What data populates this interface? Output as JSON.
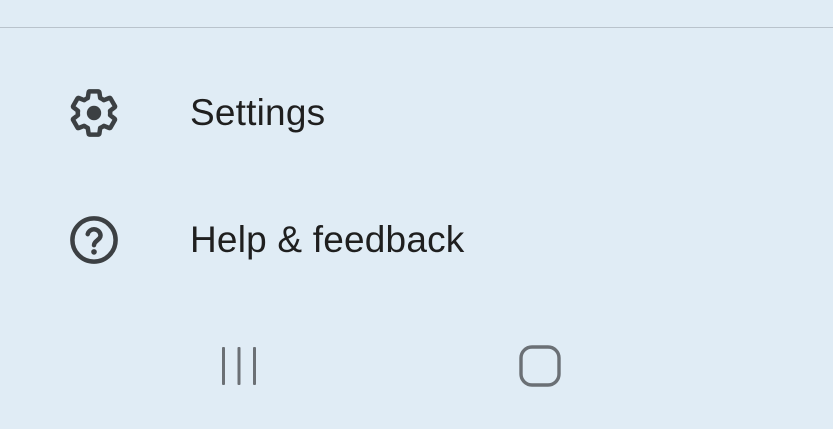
{
  "menu": {
    "items": [
      {
        "label": "Settings",
        "icon": "gear-icon"
      },
      {
        "label": "Help & feedback",
        "icon": "help-circle-icon"
      }
    ]
  },
  "navigation_bar": {
    "buttons": [
      {
        "icon": "recents-icon"
      },
      {
        "icon": "home-icon"
      }
    ]
  },
  "colors": {
    "background": "#e0ecf5",
    "divider": "#b9c3cc",
    "icon": "#3c4043",
    "text": "#1f1f1f",
    "nav_icon": "#6b7075"
  }
}
